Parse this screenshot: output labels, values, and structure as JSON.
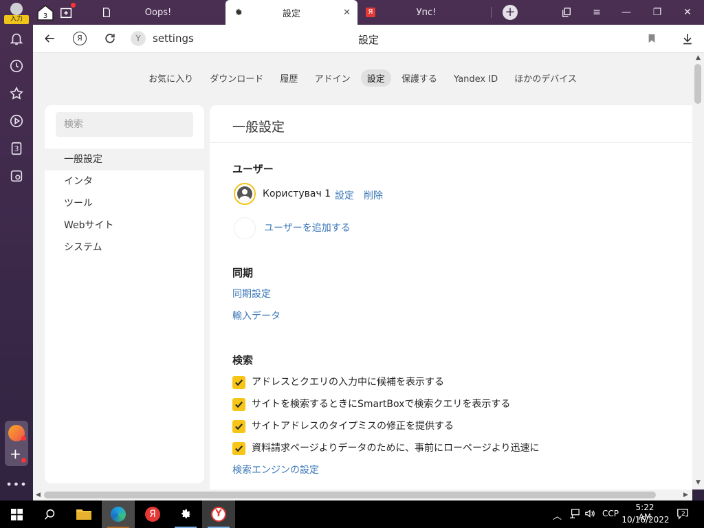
{
  "sidebar": {
    "profile_label": "入力",
    "tab_counter": "3",
    "counter_badge": "3"
  },
  "tabs": [
    {
      "title": "Oops!",
      "icon": "page-icon"
    },
    {
      "title": "設定",
      "icon": "gear-icon"
    },
    {
      "title": "Упс!",
      "icon": "yandex-icon"
    }
  ],
  "addressbar": {
    "url": "settings",
    "page_title": "設定"
  },
  "topnav": [
    "お気に入り",
    "ダウンロード",
    "履歴",
    "アドイン",
    "設定",
    "保護する",
    "Yandex ID",
    "ほかのデバイス"
  ],
  "topnav_active": "設定",
  "leftpanel": {
    "search_placeholder": "検索",
    "items": [
      "一般設定",
      "インタ",
      "ツール",
      "Webサイト",
      "システム"
    ],
    "active": "一般設定"
  },
  "main": {
    "title": "一般設定",
    "users": {
      "heading": "ユーザー",
      "user_name": "Користувач 1",
      "settings_link": "設定",
      "delete_link": "削除",
      "add_user": "ユーザーを追加する"
    },
    "sync": {
      "heading": "同期",
      "sync_settings": "同期設定",
      "import_data": "輸入データ"
    },
    "search": {
      "heading": "検索",
      "options": [
        {
          "label": "アドレスとクエリの入力中に候補を表示する",
          "checked": true
        },
        {
          "label": "サイトを検索するときにSmartBoxで検索クエリを表示する",
          "checked": true
        },
        {
          "label": "サイトアドレスのタイプミスの修正を提供する",
          "checked": true
        },
        {
          "label": "資料請求ページよりデータのために、事前にローページより迅速に",
          "checked": true
        }
      ],
      "engine_link": "検索エンジンの設定"
    }
  },
  "taskbar": {
    "lang": "ССР",
    "time": "5:22 AM",
    "date": "10/16/2022",
    "notifications": "2"
  },
  "colors": {
    "accent_yellow": "#f7c518",
    "link_blue": "#3b78b8",
    "frame_purple": "#4a2f52"
  }
}
